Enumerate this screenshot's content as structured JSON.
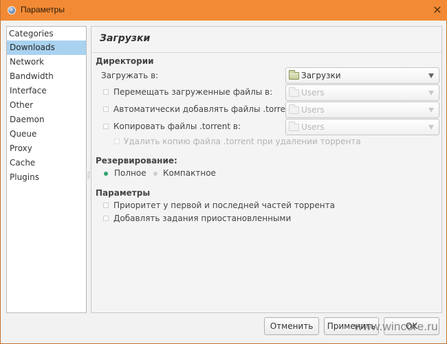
{
  "window": {
    "title": "Параметры",
    "icon": "app-globe-icon",
    "close_icon": "close-icon",
    "close_glyph": "✕"
  },
  "sidebar": {
    "header": "Categories",
    "selected": "Downloads",
    "items": [
      {
        "label": "Downloads"
      },
      {
        "label": "Network"
      },
      {
        "label": "Bandwidth"
      },
      {
        "label": "Interface"
      },
      {
        "label": "Other"
      },
      {
        "label": "Daemon"
      },
      {
        "label": "Queue"
      },
      {
        "label": "Proxy"
      },
      {
        "label": "Cache"
      },
      {
        "label": "Plugins"
      }
    ]
  },
  "page": {
    "title": "Загрузки",
    "directories": {
      "header": "Директории",
      "download_to": {
        "label": "Загружать в:",
        "value": "Загрузки",
        "icon": "folder-icon"
      },
      "move_completed": {
        "label": "Перемещать загруженные файлы в:",
        "checked": false,
        "value": "Users",
        "enabled": false
      },
      "autoadd": {
        "label": "Автоматически добавлять файлы .torrent из:",
        "checked": false,
        "value": "Users",
        "enabled": false
      },
      "copy_torrent": {
        "label": "Копировать файлы .torrent в:",
        "checked": false,
        "value": "Users",
        "enabled": false
      },
      "delete_copy": {
        "label": "Удалить копию файла .torrent при удалении торрента",
        "checked": false,
        "enabled": false
      }
    },
    "allocation": {
      "header": "Резервирование:",
      "options": [
        {
          "label": "Полное",
          "selected": true
        },
        {
          "label": "Компактное",
          "selected": false
        }
      ],
      "selected_color": "#2fa56b"
    },
    "options": {
      "header": "Параметры",
      "items": [
        {
          "label": "Приоритет у первой и последней частей торрента",
          "checked": false
        },
        {
          "label": "Добавлять задания приостановленными",
          "checked": false
        }
      ]
    }
  },
  "buttons": {
    "cancel": "Отменить",
    "apply": "Применить",
    "ok": "OK"
  },
  "watermark": "www.wincore.ru",
  "colors": {
    "titlebar": "#f28a35",
    "selection": "#a9d2f0"
  }
}
